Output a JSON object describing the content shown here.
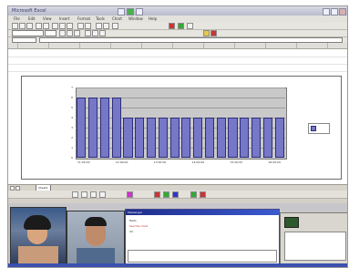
{
  "window": {
    "title": "Microsoft Excel"
  },
  "menu": {
    "items": [
      "File",
      "Edit",
      "View",
      "Insert",
      "Format",
      "Tools",
      "Chart",
      "Window",
      "Help"
    ]
  },
  "colors": {
    "bar": "#7777c8",
    "bar_edge": "#2d2d7a",
    "plot_bg": "#c9c9c9"
  },
  "chart_data": {
    "type": "bar",
    "title": "",
    "xlabel": "",
    "ylabel": "",
    "ylim": [
      0,
      7
    ],
    "grid": true,
    "legend": "right",
    "yticks": [
      "0",
      "1",
      "2",
      "3",
      "4",
      "5",
      "6",
      "7"
    ],
    "xtick_labels": [
      "11:00:00",
      "12:00:00",
      "13:00:00",
      "14:00:00",
      "15:00:00",
      "16:00:00"
    ],
    "values": [
      6,
      6,
      6,
      6,
      4,
      4,
      4,
      4,
      4,
      4,
      4,
      4,
      4,
      4,
      4,
      4,
      4,
      4
    ],
    "series": [
      {
        "values": [
          6,
          6,
          6,
          6,
          4,
          4,
          4,
          4,
          4,
          4,
          4,
          4,
          4,
          4,
          4,
          4,
          4,
          4
        ]
      }
    ]
  },
  "sheet_tabs": [
    "Sheet1"
  ],
  "chat": {
    "title": "Messenger",
    "lines": [
      {
        "text": "Hello",
        "color": "#222222"
      },
      {
        "text": "See the chart",
        "color": "#c03030"
      },
      {
        "text": "OK",
        "color": "#2a6a2a"
      }
    ]
  }
}
